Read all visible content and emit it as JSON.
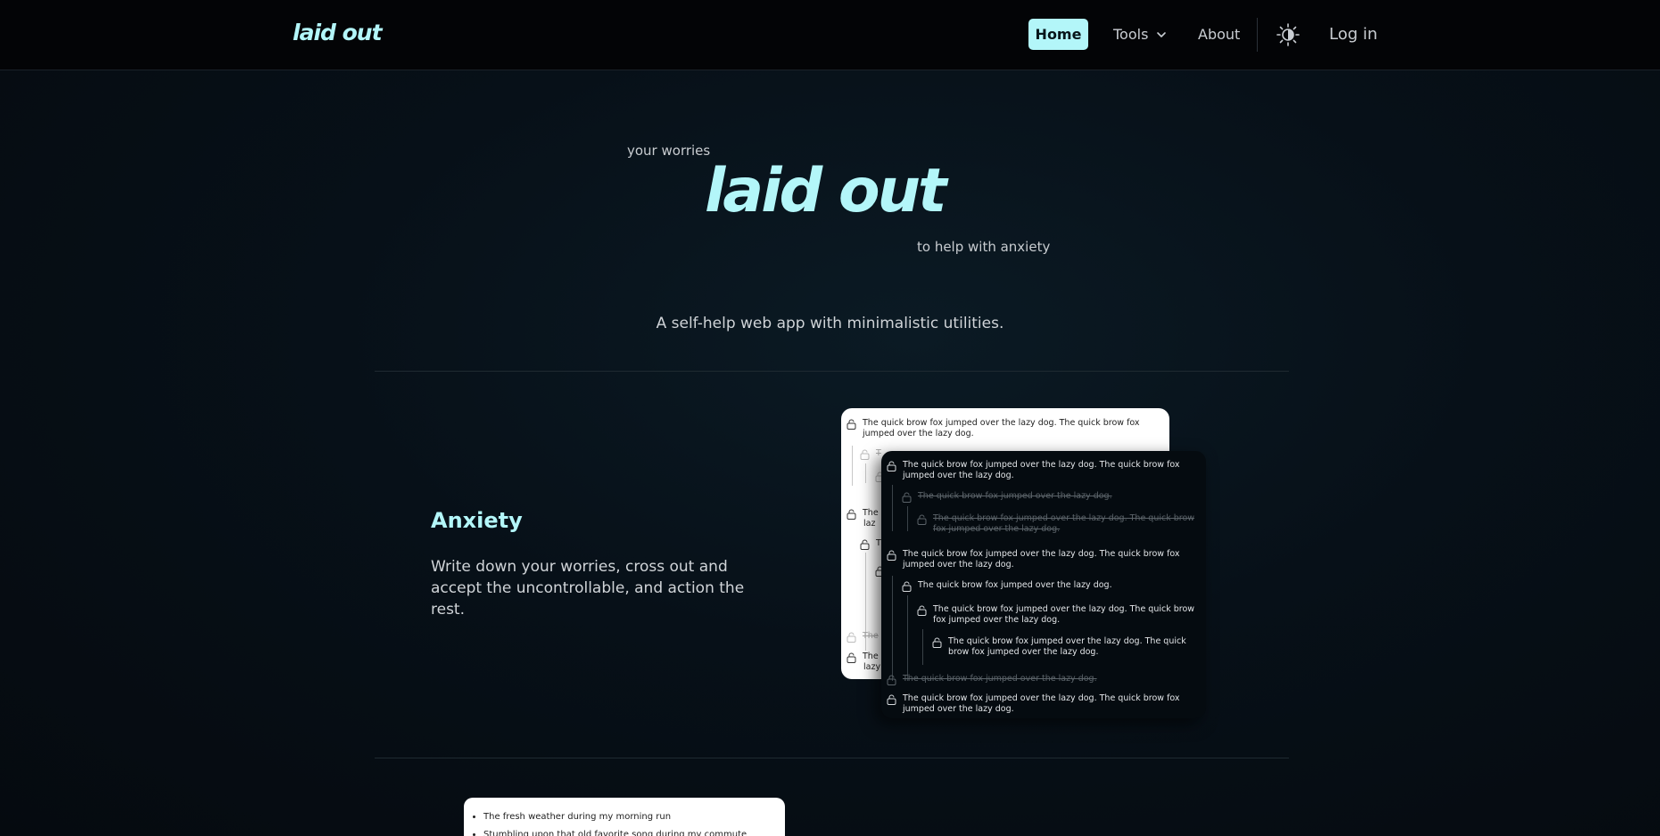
{
  "nav": {
    "brand": "laid out",
    "home": "Home",
    "tools": "Tools",
    "about": "About",
    "login": "Log in",
    "accent": "#b3f6f9"
  },
  "hero": {
    "top_small": "your worries",
    "title": "laid out",
    "bottom_small": "to help with anxiety",
    "subtitle": "A self-help web app with minimalistic utilities."
  },
  "feature": {
    "title": "Anxiety",
    "text": "Write down your worries, cross out and accept the uncontrollable, and action the rest."
  },
  "mock_light": {
    "rows": [
      "The quick brow fox jumped over the lazy dog. The quick brow fox jumped over the lazy dog.",
      "T",
      "T",
      "The q",
      "laz",
      "T",
      "T",
      "The",
      "The q",
      "lazy"
    ]
  },
  "mock_dark": {
    "rows": [
      "The quick brow fox jumped over the lazy dog. The quick brow fox jumped over the lazy dog.",
      "The quick brow fox jumped over the lazy dog.",
      "The quick brow fox jumped over the lazy dog. The quick brow fox jumped over the lazy dog.",
      "The quick brow fox jumped over the lazy dog. The quick brow fox jumped over the lazy dog.",
      "The quick brow fox jumped over the lazy dog.",
      "The quick brow fox jumped over the lazy dog. The quick brow fox jumped over the lazy dog.",
      "The quick brow fox jumped over the lazy dog. The quick brow fox jumped over the lazy dog.",
      "The quick brow fox jumped over the lazy dog.",
      "The quick brow fox jumped over the lazy dog. The quick brow fox jumped over the lazy dog."
    ]
  },
  "mock_bottom": {
    "items": [
      "The fresh weather during my morning run",
      "Stumbling upon that old favorite song during my commute"
    ]
  }
}
